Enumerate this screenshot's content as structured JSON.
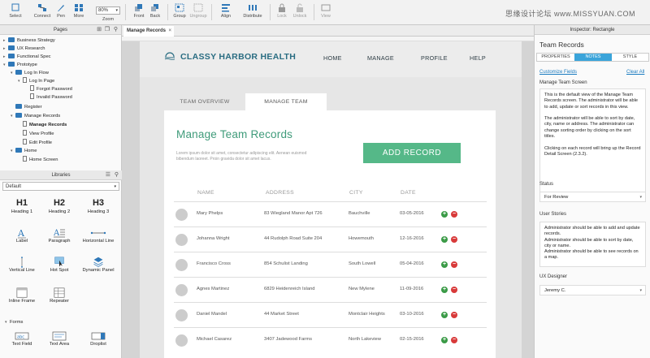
{
  "toolbar": {
    "buttons": [
      {
        "label": "Select",
        "icon": "select-icon"
      },
      {
        "label": "Connect",
        "icon": "connect-icon"
      },
      {
        "label": "Pen",
        "icon": "pen-icon"
      },
      {
        "label": "More",
        "icon": "more-icon"
      },
      {
        "label": "Front",
        "icon": "front-icon"
      },
      {
        "label": "Back",
        "icon": "back-icon"
      },
      {
        "label": "Group",
        "icon": "group-icon"
      },
      {
        "label": "Ungroup",
        "icon": "ungroup-icon"
      },
      {
        "label": "Align",
        "icon": "align-icon"
      },
      {
        "label": "Distribute",
        "icon": "distribute-icon"
      },
      {
        "label": "Lock",
        "icon": "lock-icon"
      },
      {
        "label": "Unlock",
        "icon": "unlock-icon"
      },
      {
        "label": "View",
        "icon": "view-icon"
      }
    ],
    "zoom_value": "80%",
    "zoom_label": "Zoom",
    "watermark": "思缘设计论坛 www.MISSYUAN.COM"
  },
  "pages_panel": {
    "title": "Pages",
    "tree": [
      {
        "label": "Business Strategy",
        "type": "folder"
      },
      {
        "label": "UX Research",
        "type": "folder"
      },
      {
        "label": "Functional Spec",
        "type": "folder"
      },
      {
        "label": "Prototype",
        "type": "folder"
      },
      {
        "label": "Log In Flow",
        "type": "folder"
      },
      {
        "label": "Log In Page",
        "type": "page"
      },
      {
        "label": "Forgot Password",
        "type": "page"
      },
      {
        "label": "Invalid Password",
        "type": "page"
      },
      {
        "label": "Register",
        "type": "folder"
      },
      {
        "label": "Manage Records",
        "type": "folder"
      },
      {
        "label": "Manage Records",
        "type": "page"
      },
      {
        "label": "View Profile",
        "type": "page"
      },
      {
        "label": "Edit Profile",
        "type": "page"
      },
      {
        "label": "Home",
        "type": "folder"
      },
      {
        "label": "Home Screen",
        "type": "page"
      }
    ]
  },
  "libraries_panel": {
    "title": "Libraries",
    "selected_library": "Default",
    "widgets": [
      "Heading 1",
      "Heading 2",
      "Heading 3",
      "Label",
      "Paragraph",
      "Horizontal Line",
      "Vertical Line",
      "Hot Spot",
      "Dynamic Panel",
      "Inline Frame",
      "Repeater"
    ],
    "heading_glyphs": [
      "H1",
      "H2",
      "H3"
    ],
    "forms_section": "Forms",
    "form_widgets": [
      "Text Field",
      "Text Area",
      "Droplist"
    ]
  },
  "document_tab": {
    "label": "Manage Records"
  },
  "app": {
    "brand": "CLASSY HARBOR HEALTH",
    "nav": [
      "HOME",
      "MANAGE",
      "PROFILE",
      "HELP"
    ],
    "tabs": [
      "TEAM OVERVIEW",
      "MANAGE TEAM"
    ],
    "title": "Manage Team Records",
    "description": "Lorem ipsum dolor sit amet, consectetur adipiscing elit. Aenean euismod bibendum laoreet. Proin gravida dolor sit amet lacus.",
    "add_button": "ADD RECORD",
    "columns": [
      "NAME",
      "ADDRESS",
      "CITY",
      "DATE"
    ],
    "rows": [
      {
        "name": "Mary Phelps",
        "address": "83 Wiegland Manor Apt 726",
        "city": "Bauchville",
        "date": "03-05-2016"
      },
      {
        "name": "Johanna Wright",
        "address": "44 Rudolph Road Suite 204",
        "city": "Howemouth",
        "date": "12-16-2016"
      },
      {
        "name": "Francisco Cross",
        "address": "854 Schulist Landing",
        "city": "South Lowell",
        "date": "05-04-2016"
      },
      {
        "name": "Agnes Martinez",
        "address": "6829 Heidenreich Island",
        "city": "New Mylene",
        "date": "11-09-2016"
      },
      {
        "name": "Daniel Mandel",
        "address": "44 Market Street",
        "city": "Montclair Heights",
        "date": "03-10-2016"
      },
      {
        "name": "Michael Casarez",
        "address": "3407 Jadewood Farms",
        "city": "North Lakeview",
        "date": "02-15-2016"
      }
    ]
  },
  "inspector": {
    "header": "Inspector: Rectangle",
    "name": "Team Records",
    "tabs": [
      "PROPERTIES",
      "NOTES",
      "STYLE"
    ],
    "customize_fields": "Customize Fields",
    "clear_all": "Clear All",
    "screen_label": "Manage Team Screen",
    "screen_notes": "This is the default view of the Manage Team Records screen. The administrator will be able to add, update or sort records in this view.\n\nThe administrator will be able to sort by date, city, name or address. The administrator can change sorting order by clicking on the sort titles.\n\nClicking on each record will bring up the Record Detail Screen (2.3.2).",
    "status_label": "Status",
    "status_value": "For Review",
    "stories_label": "User Stories",
    "stories_notes": "Administrator should be able to add and update records.\nAdministrator should be able to sort by date, city or name.\nAdministrator should be able to see records on a map.",
    "designer_label": "UX Designer",
    "designer_value": "Jeremy C."
  },
  "colors": {
    "accent_green": "#55b888",
    "title_green": "#3f9b7a",
    "brand_teal": "#2a6d82",
    "tab_blue": "#3aa4da"
  }
}
